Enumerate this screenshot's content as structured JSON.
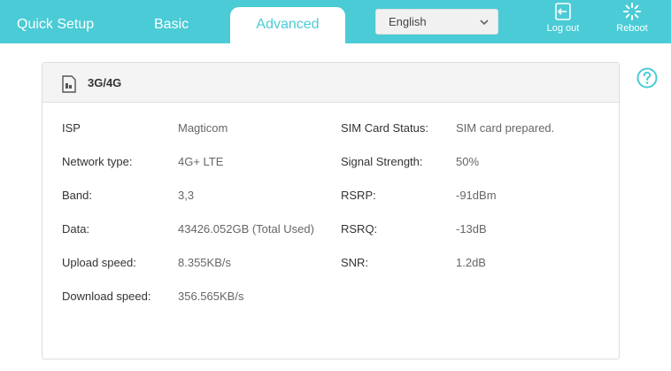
{
  "nav": {
    "tabs": [
      {
        "label": "Quick Setup"
      },
      {
        "label": "Basic"
      },
      {
        "label": "Advanced"
      }
    ],
    "language": "English",
    "logout_label": "Log out",
    "reboot_label": "Reboot"
  },
  "panel": {
    "title": "3G/4G",
    "left": [
      {
        "key": "ISP",
        "value": "Magticom"
      },
      {
        "key": "Network type:",
        "value": "4G+ LTE"
      },
      {
        "key": "Band:",
        "value": "3,3"
      },
      {
        "key": "Data:",
        "value": "43426.052GB (Total Used)"
      },
      {
        "key": "Upload speed:",
        "value": "8.355KB/s"
      },
      {
        "key": "Download speed:",
        "value": "356.565KB/s"
      }
    ],
    "right": [
      {
        "key": "SIM Card Status:",
        "value": "SIM card prepared."
      },
      {
        "key": "Signal Strength:",
        "value": "50%"
      },
      {
        "key": "RSRP:",
        "value": "-91dBm"
      },
      {
        "key": "RSRQ:",
        "value": "-13dB"
      },
      {
        "key": "SNR:",
        "value": "1.2dB"
      }
    ]
  },
  "colors": {
    "accent": "#4acbd6"
  },
  "icons": [
    "logout-icon",
    "reboot-icon",
    "chevron-down-icon",
    "help-icon",
    "sim-card-icon"
  ]
}
